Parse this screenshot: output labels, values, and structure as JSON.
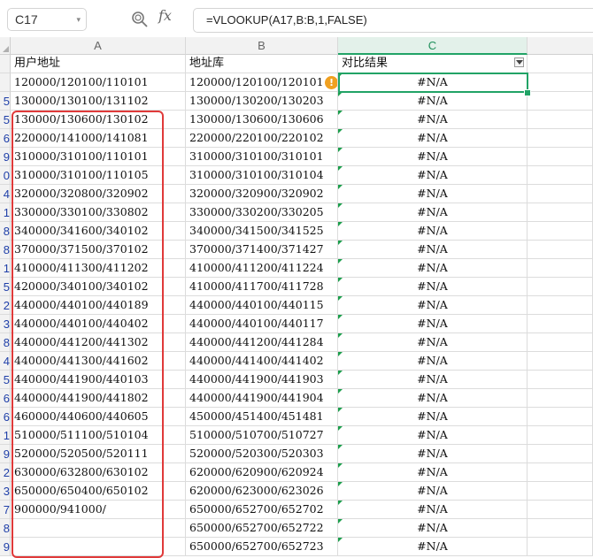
{
  "formula_bar": {
    "name_box": "C17",
    "fx_label": "fx",
    "formula": "=VLOOKUP(A17,B:B,1,FALSE)"
  },
  "columns": [
    "A",
    "B",
    "C"
  ],
  "header_row": {
    "row_number": "",
    "a": "用户地址",
    "b": "地址库",
    "c": "对比结果"
  },
  "rows": [
    {
      "num": "",
      "a": "120000/120100/110101",
      "b": "120000/120100/120101",
      "c": "#N/A"
    },
    {
      "num": "5",
      "a": "130000/130100/131102",
      "b": "130000/130200/130203",
      "c": "#N/A"
    },
    {
      "num": "5",
      "a": "130000/130600/130102",
      "b": "130000/130600/130606",
      "c": "#N/A"
    },
    {
      "num": "6",
      "a": "220000/141000/141081",
      "b": "220000/220100/220102",
      "c": "#N/A"
    },
    {
      "num": "9",
      "a": "310000/310100/110101",
      "b": "310000/310100/310101",
      "c": "#N/A"
    },
    {
      "num": "0",
      "a": "310000/310100/110105",
      "b": "310000/310100/310104",
      "c": "#N/A"
    },
    {
      "num": "4",
      "a": "320000/320800/320902",
      "b": "320000/320900/320902",
      "c": "#N/A"
    },
    {
      "num": "1",
      "a": "330000/330100/330802",
      "b": "330000/330200/330205",
      "c": "#N/A"
    },
    {
      "num": "8",
      "a": "340000/341600/340102",
      "b": "340000/341500/341525",
      "c": "#N/A"
    },
    {
      "num": "8",
      "a": "370000/371500/370102",
      "b": "370000/371400/371427",
      "c": "#N/A"
    },
    {
      "num": "1",
      "a": "410000/411300/411202",
      "b": "410000/411200/411224",
      "c": "#N/A"
    },
    {
      "num": "5",
      "a": "420000/340100/340102",
      "b": "410000/411700/411728",
      "c": "#N/A"
    },
    {
      "num": "2",
      "a": "440000/440100/440189",
      "b": "440000/440100/440115",
      "c": "#N/A"
    },
    {
      "num": "3",
      "a": "440000/440100/440402",
      "b": "440000/440100/440117",
      "c": "#N/A"
    },
    {
      "num": "8",
      "a": "440000/441200/441302",
      "b": "440000/441200/441284",
      "c": "#N/A"
    },
    {
      "num": "4",
      "a": "440000/441300/441602",
      "b": "440000/441400/441402",
      "c": "#N/A"
    },
    {
      "num": "5",
      "a": "440000/441900/440103",
      "b": "440000/441900/441903",
      "c": "#N/A"
    },
    {
      "num": "6",
      "a": "440000/441900/441802",
      "b": "440000/441900/441904",
      "c": "#N/A"
    },
    {
      "num": "6",
      "a": "460000/440600/440605",
      "b": "450000/451400/451481",
      "c": "#N/A"
    },
    {
      "num": "1",
      "a": "510000/511100/510104",
      "b": "510000/510700/510727",
      "c": "#N/A"
    },
    {
      "num": "9",
      "a": "520000/520500/520111",
      "b": "520000/520300/520303",
      "c": "#N/A"
    },
    {
      "num": "2",
      "a": "630000/632800/630102",
      "b": "620000/620900/620924",
      "c": "#N/A"
    },
    {
      "num": "3",
      "a": "650000/650400/650102",
      "b": "620000/623000/623026",
      "c": "#N/A"
    },
    {
      "num": "7",
      "a": "900000/941000/",
      "b": "650000/652700/652702",
      "c": "#N/A"
    },
    {
      "num": "8",
      "a": "",
      "b": "650000/652700/652722",
      "c": "#N/A"
    },
    {
      "num": "9",
      "a": "",
      "b": "650000/652700/652723",
      "c": "#N/A"
    }
  ],
  "colors": {
    "selection_green": "#21a366",
    "annotation_red": "#e03a3a",
    "warning_orange": "#f0a020",
    "row_number_blue": "#1f3fa8"
  }
}
